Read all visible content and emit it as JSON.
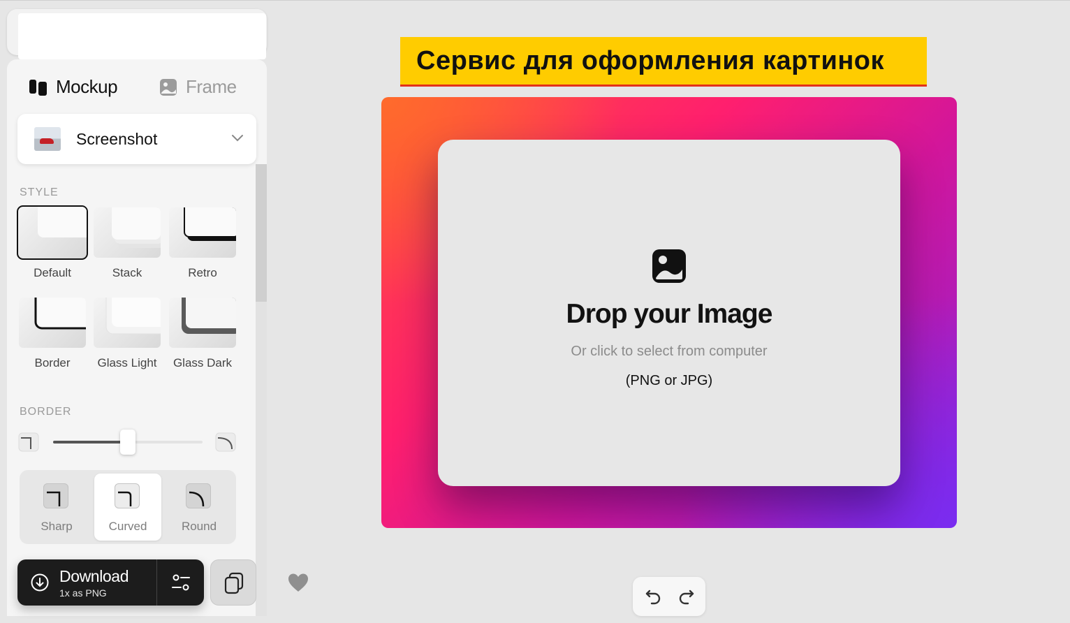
{
  "banner": {
    "title": "Сервис для оформления картинок"
  },
  "tabs": [
    {
      "label": "Mockup",
      "icon": "mockup-icon",
      "active": true
    },
    {
      "label": "Frame",
      "icon": "image-icon",
      "active": false
    }
  ],
  "mockup_selector": {
    "value": "Screenshot",
    "icon": "chevron-down-icon"
  },
  "style": {
    "label": "STYLE",
    "options": [
      {
        "label": "Default",
        "selected": true
      },
      {
        "label": "Stack",
        "selected": false
      },
      {
        "label": "Retro",
        "selected": false
      },
      {
        "label": "Border",
        "selected": false
      },
      {
        "label": "Glass Light",
        "selected": false
      },
      {
        "label": "Glass Dark",
        "selected": false
      }
    ]
  },
  "border": {
    "label": "BORDER",
    "radius_level": 0.5,
    "shapes": [
      {
        "label": "Sharp",
        "active": false
      },
      {
        "label": "Curved",
        "active": true
      },
      {
        "label": "Round",
        "active": false
      }
    ]
  },
  "download": {
    "label": "Download",
    "sublabel": "1x as PNG"
  },
  "dropzone": {
    "title": "Drop your Image",
    "subtitle": "Or click to select from computer",
    "formats": "(PNG or JPG)"
  },
  "colors": {
    "accent": "#ffcc00",
    "dark": "#1c1c1c",
    "gradient_start": "#ff6b2c",
    "gradient_mid": "#ff1f6e",
    "gradient_end": "#7a2cf0"
  }
}
